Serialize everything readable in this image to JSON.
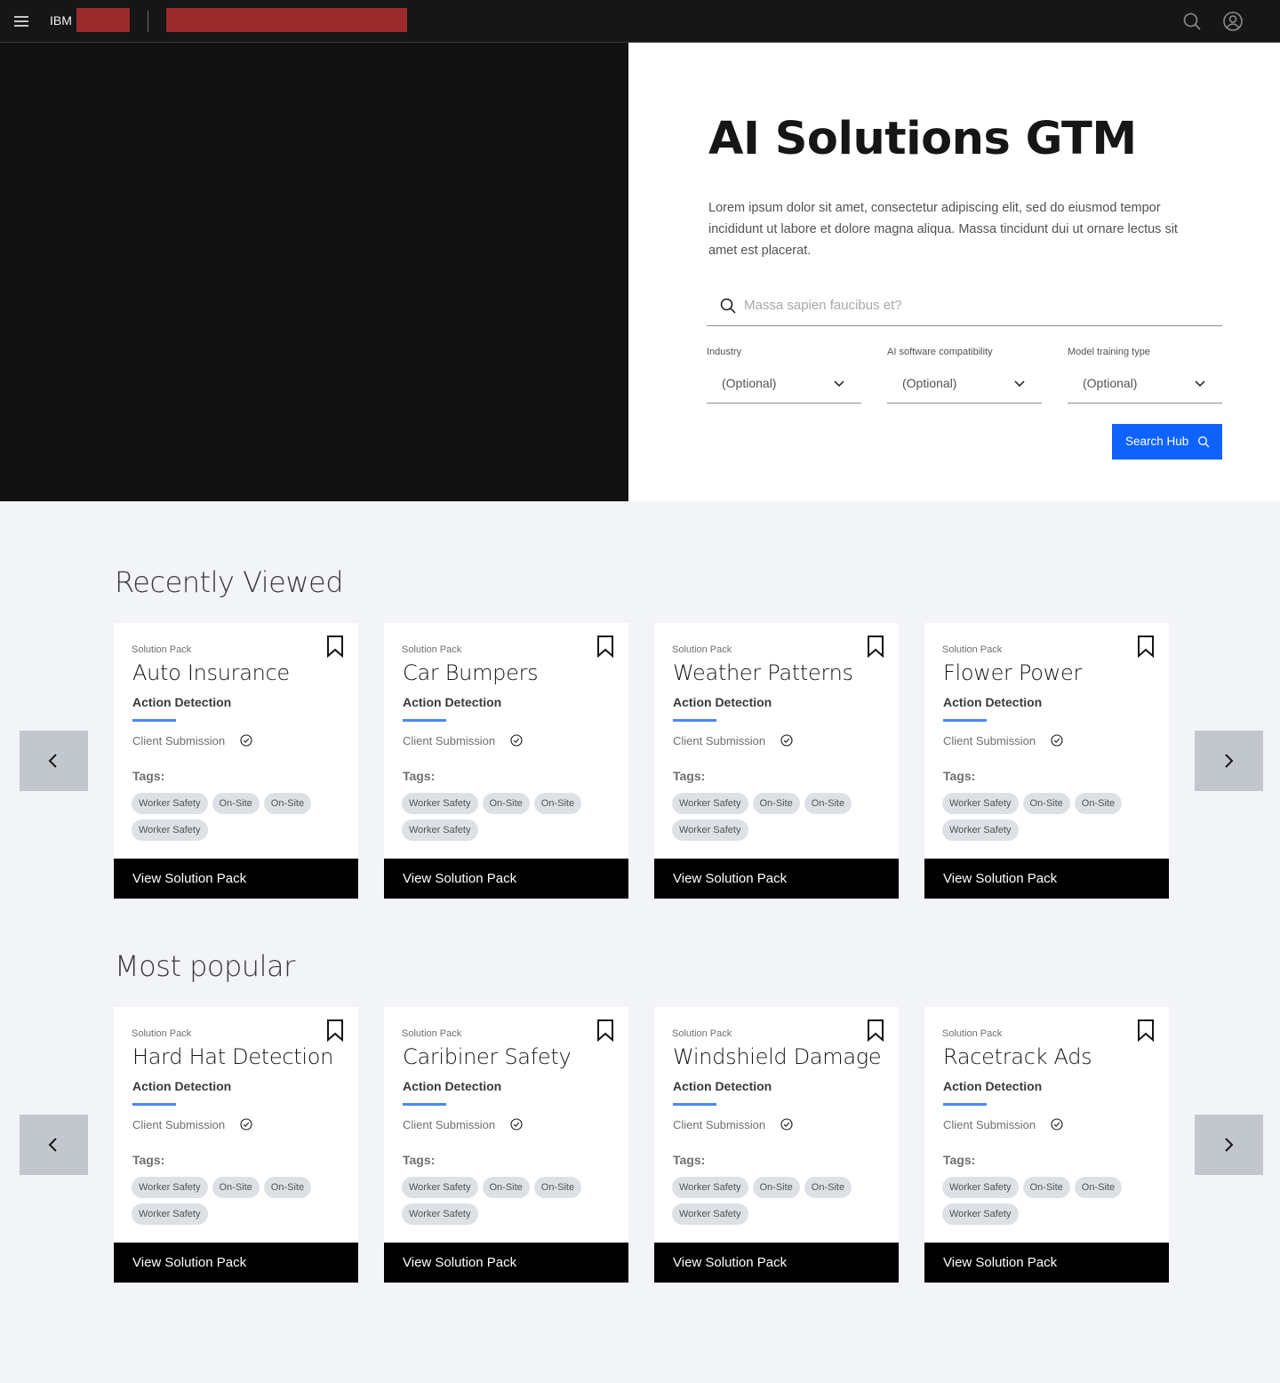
{
  "header": {
    "brand": "IBM",
    "redaction_color": "#9a2a2a",
    "icons": [
      "hamburger-icon",
      "search-icon",
      "user-avatar-icon"
    ]
  },
  "hero": {
    "title": "AI Solutions GTM",
    "description": "Lorem ipsum dolor sit amet, consectetur adipiscing elit, sed do eiusmod tempor incididunt ut labore et dolore magna aliqua. Massa tincidunt dui ut ornare lectus sit amet est placerat.",
    "search_placeholder": "Massa sapien faucibus et?",
    "filters": [
      {
        "label": "Industry",
        "value": "(Optional)"
      },
      {
        "label": "AI software compatibility",
        "value": "(Optional)"
      },
      {
        "label": "Model training type",
        "value": "(Optional)"
      }
    ],
    "search_button": "Search Hub",
    "accent_color": "#0f62fe"
  },
  "sections": [
    {
      "title": "Recently Viewed",
      "cards": [
        {
          "kicker": "Solution Pack",
          "title": "Auto Insurance",
          "type": "Action Detection",
          "source": "Client Submission",
          "tags_label": "Tags:",
          "tags": [
            "Worker Safety",
            "On-Site",
            "On-Site",
            "Worker Safety"
          ],
          "cta": "View Solution Pack"
        },
        {
          "kicker": "Solution Pack",
          "title": "Car Bumpers",
          "type": "Action Detection",
          "source": "Client Submission",
          "tags_label": "Tags:",
          "tags": [
            "Worker Safety",
            "On-Site",
            "On-Site",
            "Worker Safety"
          ],
          "cta": "View Solution Pack"
        },
        {
          "kicker": "Solution Pack",
          "title": "Weather Patterns",
          "type": "Action Detection",
          "source": "Client Submission",
          "tags_label": "Tags:",
          "tags": [
            "Worker Safety",
            "On-Site",
            "On-Site",
            "Worker Safety"
          ],
          "cta": "View Solution Pack"
        },
        {
          "kicker": "Solution Pack",
          "title": "Flower Power",
          "type": "Action Detection",
          "source": "Client Submission",
          "tags_label": "Tags:",
          "tags": [
            "Worker Safety",
            "On-Site",
            "On-Site",
            "Worker Safety"
          ],
          "cta": "View Solution Pack"
        }
      ]
    },
    {
      "title": "Most popular",
      "cards": [
        {
          "kicker": "Solution Pack",
          "title": "Hard Hat Detection",
          "type": "Action Detection",
          "source": "Client Submission",
          "tags_label": "Tags:",
          "tags": [
            "Worker Safety",
            "On-Site",
            "On-Site",
            "Worker Safety"
          ],
          "cta": "View Solution Pack"
        },
        {
          "kicker": "Solution Pack",
          "title": "Caribiner Safety",
          "type": "Action Detection",
          "source": "Client Submission",
          "tags_label": "Tags:",
          "tags": [
            "Worker Safety",
            "On-Site",
            "On-Site",
            "Worker Safety"
          ],
          "cta": "View Solution Pack"
        },
        {
          "kicker": "Solution Pack",
          "title": "Windshield Damage",
          "type": "Action Detection",
          "source": "Client Submission",
          "tags_label": "Tags:",
          "tags": [
            "Worker Safety",
            "On-Site",
            "On-Site",
            "Worker Safety"
          ],
          "cta": "View Solution Pack"
        },
        {
          "kicker": "Solution Pack",
          "title": "Racetrack Ads",
          "type": "Action Detection",
          "source": "Client Submission",
          "tags_label": "Tags:",
          "tags": [
            "Worker Safety",
            "On-Site",
            "On-Site",
            "Worker Safety"
          ],
          "cta": "View Solution Pack"
        }
      ]
    }
  ]
}
